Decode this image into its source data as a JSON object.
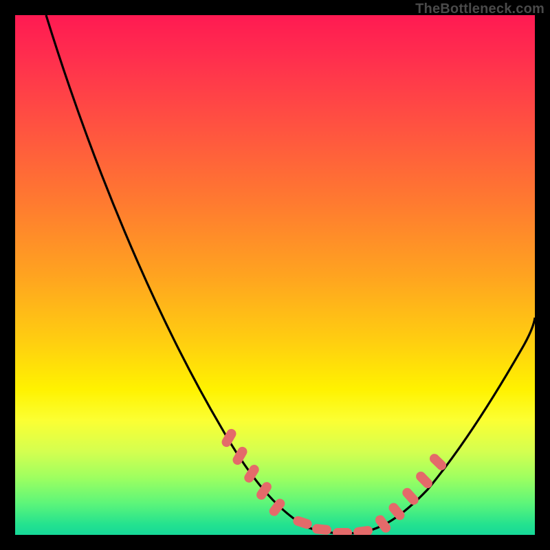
{
  "watermark": "TheBottleneck.com",
  "chart_data": {
    "type": "line",
    "title": "",
    "xlabel": "",
    "ylabel": "",
    "xlim": [
      0,
      100
    ],
    "ylim": [
      0,
      100
    ],
    "x": [
      6,
      10,
      14,
      18,
      22,
      26,
      30,
      34,
      38,
      41,
      44,
      47,
      50,
      53,
      56,
      58,
      60,
      63,
      66,
      70,
      74,
      78,
      82,
      86,
      90,
      94,
      98,
      100
    ],
    "values": [
      100,
      92,
      84,
      76,
      68,
      60,
      52,
      44,
      36,
      29,
      23,
      17,
      11,
      6,
      3,
      1,
      0,
      0,
      1,
      4,
      9,
      15,
      22,
      29,
      36,
      43,
      49,
      53
    ],
    "annotations": {
      "note": "Salmon marker clusters overlay the curve near the trough region",
      "marker_regions": [
        {
          "x_range": [
            41,
            49
          ],
          "side": "left"
        },
        {
          "x_range": [
            54,
            68
          ],
          "side": "bottom"
        },
        {
          "x_range": [
            70,
            79
          ],
          "side": "right"
        }
      ]
    }
  },
  "colors": {
    "curve": "#000000",
    "markers": "#e46a6a",
    "background_top": "#ff1a52",
    "background_bottom": "#16d898",
    "frame": "#000000"
  }
}
